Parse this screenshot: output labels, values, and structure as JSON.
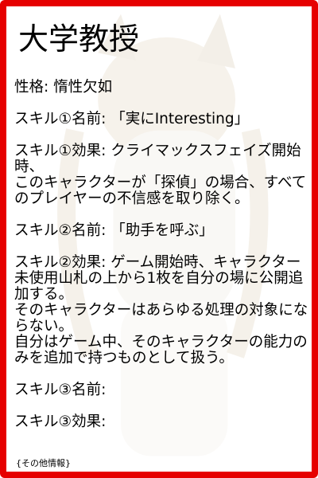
{
  "card": {
    "title": "大学教授",
    "personality": "性格: 惰性欠如",
    "skill1_name": "スキル①名前: 「実にInteresting」",
    "skill1_effect_a": "スキル①効果: クライマックスフェイズ開始時、",
    "skill1_effect_b": "このキャラクターが「探偵」の場合、すべてのプレイヤーの不信感を取り除く。",
    "skill2_name": "スキル②名前: 「助手を呼ぶ」",
    "skill2_effect_a": "スキル②効果: ゲーム開始時、キャラクター未使用山札の上から1枚を自分の場に公開追加する。",
    "skill2_effect_b": "そのキャラクターはあらゆる処理の対象にならない。",
    "skill2_effect_c": "自分はゲーム中、そのキャラクターの能力のみを追加で持つものとして扱う。",
    "skill3_name": "スキル③名前:",
    "skill3_effect": "スキル③効果:",
    "footer": "{その他情報}"
  },
  "colors": {
    "border": "#e60000",
    "text": "#000000",
    "background": "#ffffff"
  }
}
